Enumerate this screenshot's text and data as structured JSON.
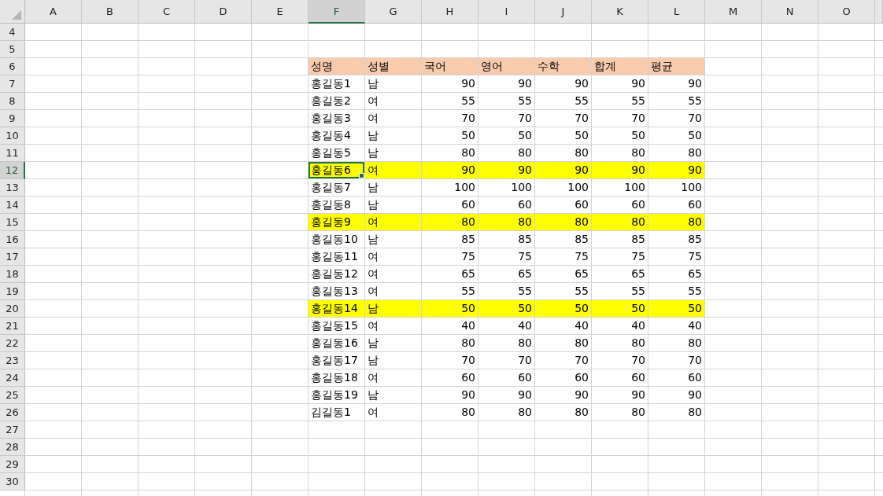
{
  "columns": [
    {
      "label": "A",
      "selected": false
    },
    {
      "label": "B",
      "selected": false
    },
    {
      "label": "C",
      "selected": false
    },
    {
      "label": "D",
      "selected": false
    },
    {
      "label": "E",
      "selected": false
    },
    {
      "label": "F",
      "selected": true
    },
    {
      "label": "G",
      "selected": false
    },
    {
      "label": "H",
      "selected": false
    },
    {
      "label": "I",
      "selected": false
    },
    {
      "label": "J",
      "selected": false
    },
    {
      "label": "K",
      "selected": false
    },
    {
      "label": "L",
      "selected": false
    },
    {
      "label": "M",
      "selected": false
    },
    {
      "label": "N",
      "selected": false
    },
    {
      "label": "O",
      "selected": false
    }
  ],
  "rows": [
    {
      "num": "4",
      "kind": "empty",
      "selected": false
    },
    {
      "num": "5",
      "kind": "empty",
      "selected": false
    },
    {
      "num": "6",
      "kind": "header",
      "selected": false,
      "color": "#f8cbad",
      "cells": [
        "성명",
        "성별",
        "국어",
        "영어",
        "수학",
        "합계",
        "평균"
      ]
    },
    {
      "num": "7",
      "kind": "data",
      "selected": false,
      "cells": [
        "홍길동1",
        "남",
        "90",
        "90",
        "90",
        "90",
        "90"
      ]
    },
    {
      "num": "8",
      "kind": "data",
      "selected": false,
      "cells": [
        "홍길동2",
        "여",
        "55",
        "55",
        "55",
        "55",
        "55"
      ]
    },
    {
      "num": "9",
      "kind": "data",
      "selected": false,
      "cells": [
        "홍길동3",
        "여",
        "70",
        "70",
        "70",
        "70",
        "70"
      ]
    },
    {
      "num": "10",
      "kind": "data",
      "selected": false,
      "cells": [
        "홍길동4",
        "남",
        "50",
        "50",
        "50",
        "50",
        "50"
      ]
    },
    {
      "num": "11",
      "kind": "data",
      "selected": false,
      "cells": [
        "홍길동5",
        "남",
        "80",
        "80",
        "80",
        "80",
        "80"
      ]
    },
    {
      "num": "12",
      "kind": "data",
      "selected": true,
      "color": "#ffff00",
      "cells": [
        "홍길동6",
        "여",
        "90",
        "90",
        "90",
        "90",
        "90"
      ]
    },
    {
      "num": "13",
      "kind": "data",
      "selected": false,
      "cells": [
        "홍길동7",
        "남",
        "100",
        "100",
        "100",
        "100",
        "100"
      ]
    },
    {
      "num": "14",
      "kind": "data",
      "selected": false,
      "cells": [
        "홍길동8",
        "남",
        "60",
        "60",
        "60",
        "60",
        "60"
      ]
    },
    {
      "num": "15",
      "kind": "data",
      "selected": false,
      "color": "#ffff00",
      "cells": [
        "홍길동9",
        "여",
        "80",
        "80",
        "80",
        "80",
        "80"
      ]
    },
    {
      "num": "16",
      "kind": "data",
      "selected": false,
      "cells": [
        "홍길동10",
        "남",
        "85",
        "85",
        "85",
        "85",
        "85"
      ]
    },
    {
      "num": "17",
      "kind": "data",
      "selected": false,
      "cells": [
        "홍길동11",
        "여",
        "75",
        "75",
        "75",
        "75",
        "75"
      ]
    },
    {
      "num": "18",
      "kind": "data",
      "selected": false,
      "cells": [
        "홍길동12",
        "여",
        "65",
        "65",
        "65",
        "65",
        "65"
      ]
    },
    {
      "num": "19",
      "kind": "data",
      "selected": false,
      "cells": [
        "홍길동13",
        "여",
        "55",
        "55",
        "55",
        "55",
        "55"
      ]
    },
    {
      "num": "20",
      "kind": "data",
      "selected": false,
      "color": "#ffff00",
      "cells": [
        "홍길동14",
        "남",
        "50",
        "50",
        "50",
        "50",
        "50"
      ]
    },
    {
      "num": "21",
      "kind": "data",
      "selected": false,
      "cells": [
        "홍길동15",
        "여",
        "40",
        "40",
        "40",
        "40",
        "40"
      ]
    },
    {
      "num": "22",
      "kind": "data",
      "selected": false,
      "cells": [
        "홍길동16",
        "남",
        "80",
        "80",
        "80",
        "80",
        "80"
      ]
    },
    {
      "num": "23",
      "kind": "data",
      "selected": false,
      "cells": [
        "홍길동17",
        "남",
        "70",
        "70",
        "70",
        "70",
        "70"
      ]
    },
    {
      "num": "24",
      "kind": "data",
      "selected": false,
      "cells": [
        "홍길동18",
        "여",
        "60",
        "60",
        "60",
        "60",
        "60"
      ]
    },
    {
      "num": "25",
      "kind": "data",
      "selected": false,
      "cells": [
        "홍길동19",
        "남",
        "90",
        "90",
        "90",
        "90",
        "90"
      ]
    },
    {
      "num": "26",
      "kind": "data",
      "selected": false,
      "cells": [
        "김길동1",
        "여",
        "80",
        "80",
        "80",
        "80",
        "80"
      ]
    },
    {
      "num": "27",
      "kind": "empty",
      "selected": false
    },
    {
      "num": "28",
      "kind": "empty",
      "selected": false
    },
    {
      "num": "29",
      "kind": "empty",
      "selected": false
    },
    {
      "num": "30",
      "kind": "empty",
      "selected": false
    }
  ]
}
